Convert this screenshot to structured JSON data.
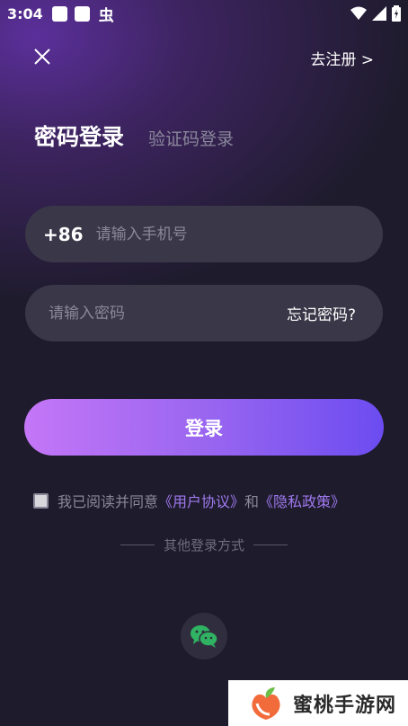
{
  "status_bar": {
    "time": "3:04",
    "notif_glyph": "虫"
  },
  "header": {
    "register_link": "去注册 >"
  },
  "tabs": {
    "active": "密码登录",
    "inactive": "验证码登录"
  },
  "phone_field": {
    "prefix": "+86",
    "placeholder": "请输入手机号",
    "value": ""
  },
  "password_field": {
    "placeholder": "请输入密码",
    "value": "",
    "forgot_label": "忘记密码?"
  },
  "login_button": {
    "label": "登录"
  },
  "agreement": {
    "prefix": "我已阅读并同意",
    "user_agreement": "《用户协议》",
    "conjunction": "和",
    "privacy_policy": "《隐私政策》",
    "checked": false
  },
  "other_login": {
    "label": "其他登录方式",
    "options": [
      "wechat-icon"
    ]
  },
  "watermark": {
    "text": "蜜桃手游网"
  },
  "colors": {
    "background": "#1e1b2c",
    "field": "#3a3848",
    "accent_start": "#c476f7",
    "accent_end": "#6c4cf0",
    "link": "#a07af0",
    "wechat": "#2fb362"
  }
}
